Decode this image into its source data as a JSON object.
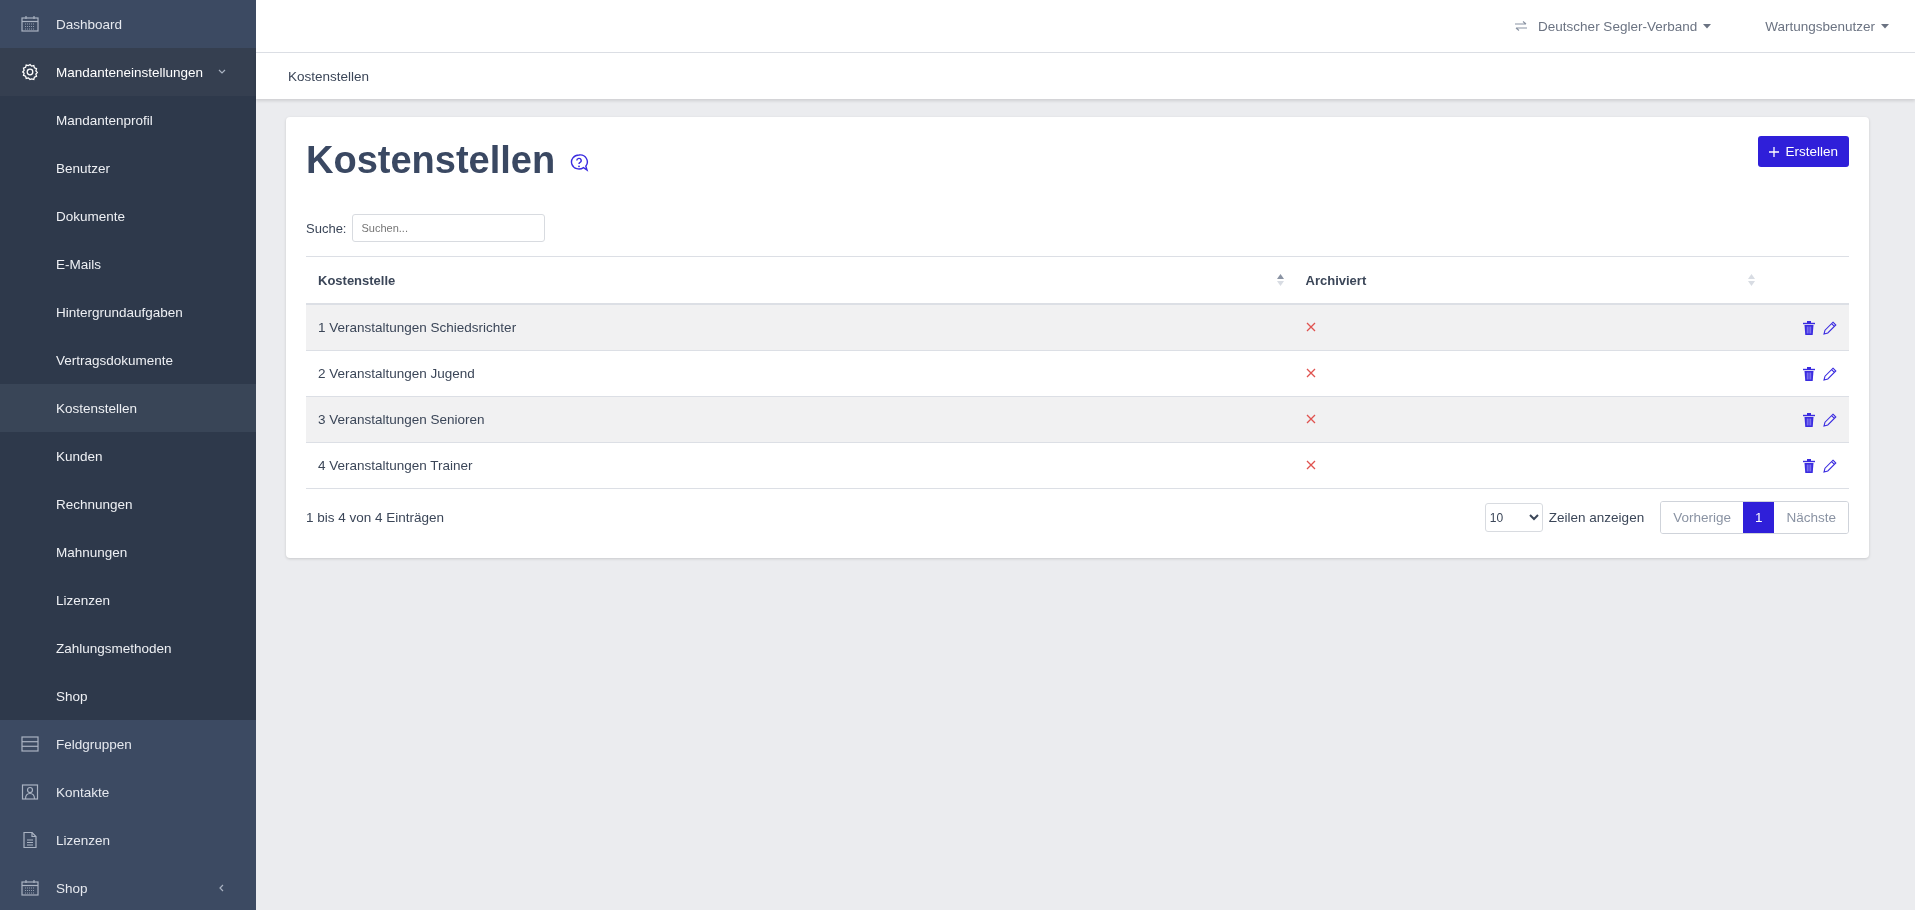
{
  "sidebar": {
    "items": [
      {
        "label": "Dashboard",
        "selected": false
      },
      {
        "label": "Mandanteneinstellungen",
        "selected": false,
        "expanded": true,
        "children": [
          {
            "label": "Mandantenprofil",
            "selected": false
          },
          {
            "label": "Benutzer",
            "selected": false
          },
          {
            "label": "Dokumente",
            "selected": false
          },
          {
            "label": "E-Mails",
            "selected": false
          },
          {
            "label": "Hintergrundaufgaben",
            "selected": false
          },
          {
            "label": "Vertragsdokumente",
            "selected": false
          },
          {
            "label": "Kostenstellen",
            "selected": true
          },
          {
            "label": "Kunden",
            "selected": false
          },
          {
            "label": "Rechnungen",
            "selected": false
          },
          {
            "label": "Mahnungen",
            "selected": false
          },
          {
            "label": "Lizenzen",
            "selected": false
          },
          {
            "label": "Zahlungsmethoden",
            "selected": false
          },
          {
            "label": "Shop",
            "selected": false
          }
        ]
      },
      {
        "label": "Feldgruppen",
        "selected": false
      },
      {
        "label": "Kontakte",
        "selected": false
      },
      {
        "label": "Lizenzen",
        "selected": false
      },
      {
        "label": "Shop",
        "selected": false,
        "expanded": false
      }
    ]
  },
  "topbar": {
    "organization": "Deutscher Segler-Verband",
    "user": "Wartungsbenutzer"
  },
  "breadcrumb": "Kostenstellen",
  "page": {
    "title": "Kostenstellen",
    "create_button": "Erstellen",
    "search": {
      "label": "Suche:",
      "placeholder": "Suchen..."
    },
    "table": {
      "columns": [
        {
          "label": "Kostenstelle",
          "sorted": true
        },
        {
          "label": "Archiviert",
          "sorted": false
        }
      ],
      "rows": [
        {
          "name": "1 Veranstaltungen Schiedsrichter",
          "archived": false
        },
        {
          "name": "2 Veranstaltungen Jugend",
          "archived": false
        },
        {
          "name": "3 Veranstaltungen Senioren",
          "archived": false
        },
        {
          "name": "4 Veranstaltungen Trainer",
          "archived": false
        }
      ]
    },
    "info": "1 bis 4 von 4 Einträgen",
    "page_size": "10",
    "page_size_label": "Zeilen anzeigen",
    "pagination": [
      {
        "label": "Vorherige",
        "selected": false
      },
      {
        "label": "1",
        "selected": true
      },
      {
        "label": "Nächste",
        "selected": false
      }
    ]
  }
}
